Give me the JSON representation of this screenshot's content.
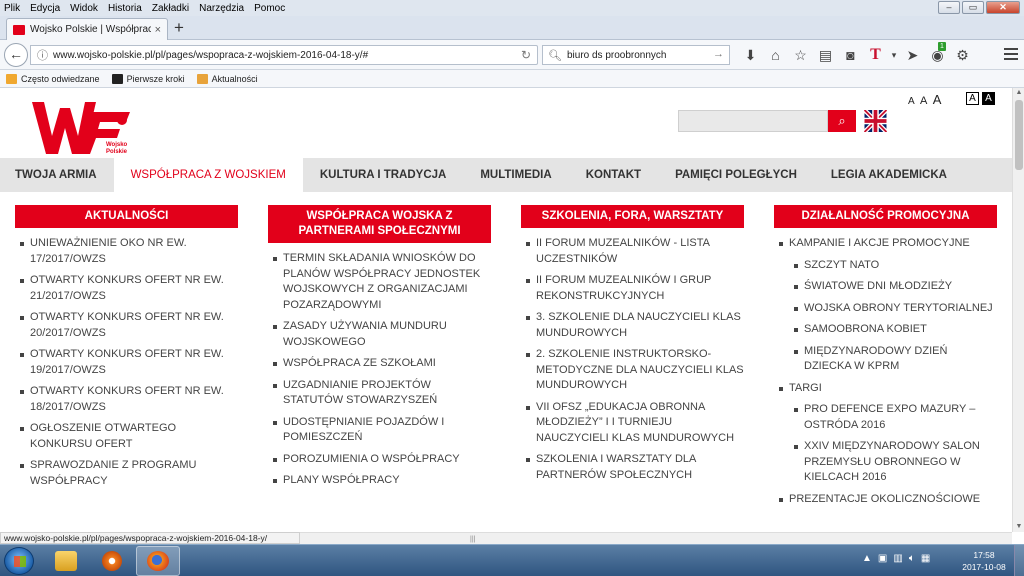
{
  "menubar": [
    "Plik",
    "Edycja",
    "Widok",
    "Historia",
    "Zakładki",
    "Narzędzia",
    "Pomoc"
  ],
  "tab": {
    "title": "Wojsko Polskie | Współpraca",
    "close": "×"
  },
  "newtab": "+",
  "url": "www.wojsko-polskie.pl/pl/pages/wspopraca-z-wojskiem-2016-04-18-y/#",
  "search": {
    "value": "biuro ds proobronnych"
  },
  "bookmarks": [
    "Często odwiedzane",
    "Pierwsze kroki",
    "Aktualności"
  ],
  "colors": {
    "brand_red": "#e2001a",
    "nav_gray": "#e4e4e4",
    "text": "#444444"
  },
  "logo": {
    "text_line1": "Wojsko",
    "text_line2": "Polskie"
  },
  "font_sizes": [
    "A",
    "A",
    "A"
  ],
  "contrast": [
    "A",
    "A"
  ],
  "nav": [
    {
      "label": "TWOJA ARMIA"
    },
    {
      "label": "WSPÓŁPRACA Z WOJSKIEM",
      "active": true
    },
    {
      "label": "KULTURA I TRADYCJA"
    },
    {
      "label": "MULTIMEDIA"
    },
    {
      "label": "KONTAKT"
    },
    {
      "label": "PAMIĘCI POLEGŁYCH"
    },
    {
      "label": "LEGIA AKADEMICKA"
    }
  ],
  "columns": [
    {
      "heading": "AKTUALNOŚCI",
      "items": [
        {
          "text": "UNIEWAŻNIENIE OKO NR EW. 17/2017/OWZS"
        },
        {
          "text": "OTWARTY KONKURS OFERT NR EW. 21/2017/OWZS"
        },
        {
          "text": "OTWARTY KONKURS OFERT NR EW. 20/2017/OWZS"
        },
        {
          "text": "OTWARTY KONKURS OFERT NR EW. 19/2017/OWZS"
        },
        {
          "text": "OTWARTY KONKURS OFERT NR EW. 18/2017/OWZS"
        },
        {
          "text": "OGŁOSZENIE OTWARTEGO KONKURSU OFERT"
        },
        {
          "text": "SPRAWOZDANIE Z PROGRAMU WSPÓŁPRACY"
        }
      ]
    },
    {
      "heading": "WSPÓŁPRACA WOJSKA Z PARTNERAMI SPOŁECZNYMI",
      "items": [
        {
          "text": "TERMIN SKŁADANIA WNIOSKÓW DO PLANÓW WSPÓŁPRACY JEDNOSTEK WOJSKOWYCH Z ORGANIZACJAMI POZARZĄDOWYMI"
        },
        {
          "text": "ZASADY UŻYWANIA MUNDURU WOJSKOWEGO"
        },
        {
          "text": "WSPÓŁPRACA ZE SZKOŁAMI"
        },
        {
          "text": "UZGADNIANIE PROJEKTÓW STATUTÓW STOWARZYSZEŃ"
        },
        {
          "text": "UDOSTĘPNIANIE POJAZDÓW I POMIESZCZEŃ"
        },
        {
          "text": "POROZUMIENIA O WSPÓŁPRACY"
        },
        {
          "text": "PLANY WSPÓŁPRACY"
        }
      ]
    },
    {
      "heading": "SZKOLENIA, FORA, WARSZTATY",
      "items": [
        {
          "text": "II FORUM MUZEALNIKÓW - LISTA UCZESTNIKÓW"
        },
        {
          "text": "II FORUM MUZEALNIKÓW I GRUP REKONSTRUKCYJNYCH"
        },
        {
          "text": "3. SZKOLENIE DLA NAUCZYCIELI KLAS MUNDUROWYCH"
        },
        {
          "text": "2. SZKOLENIE INSTRUKTORSKO-METODYCZNE DLA NAUCZYCIELI KLAS MUNDUROWYCH"
        },
        {
          "text": "VII OFSZ „EDUKACJA OBRONNA MŁODZIEŻY” I I TURNIEJU NAUCZYCIELI KLAS MUNDUROWYCH"
        },
        {
          "text": "SZKOLENIA I WARSZTATY DLA PARTNERÓW SPOŁECZNYCH"
        }
      ]
    },
    {
      "heading": "DZIAŁALNOŚĆ PROMOCYJNA",
      "items": [
        {
          "text": "KAMPANIE I AKCJE PROMOCYJNE"
        },
        {
          "text": "SZCZYT NATO",
          "sub": true
        },
        {
          "text": "ŚWIATOWE DNI MŁODZIEŻY",
          "sub": true
        },
        {
          "text": "WOJSKA OBRONY TERYTORIALNEJ",
          "sub": true
        },
        {
          "text": "SAMOOBRONA KOBIET",
          "sub": true
        },
        {
          "text": "MIĘDZYNARODOWY DZIEŃ DZIECKA W KPRM",
          "sub": true
        },
        {
          "text": "TARGI"
        },
        {
          "text": "PRO DEFENCE EXPO MAZURY – OSTRÓDA 2016",
          "sub": true
        },
        {
          "text": "XXIV MIĘDZYNARODOWY SALON PRZEMYSŁU OBRONNEGO W KIELCACH 2016",
          "sub": true
        },
        {
          "text": "PREZENTACJE OKOLICZNOŚCIOWE"
        }
      ]
    }
  ],
  "status_url": "www.wojsko-polskie.pl/pl/pages/wspopraca-z-wojskiem-2016-04-18-y/",
  "clock": {
    "time": "17:58",
    "date": "2017-10-08"
  },
  "icons": [
    "back-arrow-icon",
    "lock-info-icon",
    "reload-icon",
    "search-icon",
    "download-icon",
    "home-icon",
    "star-icon",
    "reader-icon",
    "pocket-icon",
    "menu-icon"
  ]
}
